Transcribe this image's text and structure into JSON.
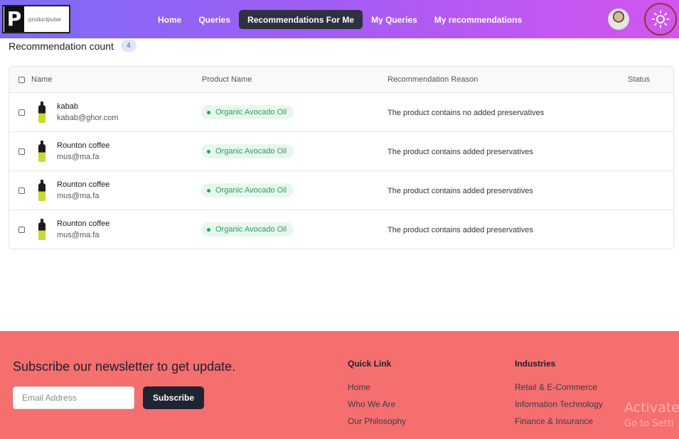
{
  "brand": {
    "logo_letter": "P",
    "logo_text": "productpulse"
  },
  "nav": {
    "items": [
      {
        "label": "Home",
        "active": false
      },
      {
        "label": "Queries",
        "active": false
      },
      {
        "label": "Recommendations For Me",
        "active": true
      },
      {
        "label": "My Queries",
        "active": false
      },
      {
        "label": "My recommendations",
        "active": false
      }
    ]
  },
  "summary": {
    "title": "Recommendation count",
    "count": "4"
  },
  "table": {
    "columns": [
      "Name",
      "Product Name",
      "Recommendation Reason",
      "Status"
    ],
    "rows": [
      {
        "name": "kabab",
        "email": "kabab@ghor.com",
        "product": "Organic Avocado Oil",
        "reason": "The product contains no added preservatives",
        "status": ""
      },
      {
        "name": "Rounton coffee",
        "email": "mus@ma.fa",
        "product": "Organic Avocado Oil",
        "reason": "The product contains added preservatives",
        "status": ""
      },
      {
        "name": "Rounton coffee",
        "email": "mus@ma.fa",
        "product": "Organic Avocado Oil",
        "reason": "The product contains added preservatives",
        "status": ""
      },
      {
        "name": "Rounton coffee",
        "email": "mus@ma.fa",
        "product": "Organic Avocado Oil",
        "reason": "The product contains added preservatives",
        "status": ""
      }
    ]
  },
  "footer": {
    "newsletter_title": "Subscribe our newsletter to get update.",
    "email_placeholder": "Email Address",
    "subscribe_label": "Subscribe",
    "quick_link": {
      "heading": "Quick Link",
      "links": [
        "Home",
        "Who We Are",
        "Our Philosophy"
      ]
    },
    "industries": {
      "heading": "Industries",
      "links": [
        "Retail & E-Commerce",
        "Information Technology",
        "Finance & Insurance"
      ]
    }
  },
  "watermark": {
    "line1": "Activate",
    "line2": "Go to Setti"
  },
  "colors": {
    "nav_gradient_start": "#7c6cf5",
    "nav_gradient_end": "#d455f0",
    "footer_bg": "#f56f6f",
    "badge_green": "#2f9a5c"
  },
  "icons": {
    "theme_toggle": "sun-icon",
    "avatar": "user-avatar"
  }
}
